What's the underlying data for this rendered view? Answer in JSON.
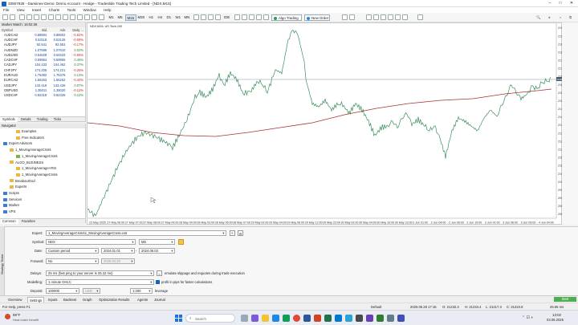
{
  "window": {
    "title": "33507928 - Darwinex-Demo: Demo Account - Hedge - Tradeslide Trading Tech Limited - [NDX,M15]"
  },
  "menu": [
    "File",
    "View",
    "Insert",
    "Charts",
    "Tools",
    "Window",
    "Help"
  ],
  "toolbar": {
    "timeframes": [
      "M1",
      "M5",
      "M15",
      "M30",
      "H1",
      "H4",
      "D1",
      "W1",
      "MN"
    ],
    "active_timeframe": "M15",
    "ide_label": "IDE",
    "algo_label": "Algo Trading",
    "new_order_label": "New Order"
  },
  "market_watch": {
    "title": "Market Watch: 16:02:36",
    "columns": [
      "Symbol",
      "Bid",
      "Ask",
      "Daily ..."
    ],
    "rows": [
      {
        "symbol": "AUDCAD",
        "bid": "0.88594",
        "ask": "0.88602",
        "change": "-0.52%"
      },
      {
        "symbol": "AUDCHF",
        "bid": "0.53118",
        "ask": "0.53126",
        "change": "-0.08%"
      },
      {
        "symbol": "AUDJPY",
        "bid": "92.541",
        "ask": "92.553",
        "change": "-0.17%"
      },
      {
        "symbol": "AUDNZD",
        "bid": "1.07599",
        "ask": "1.07610",
        "change": "0.02%"
      },
      {
        "symbol": "AUDUSD",
        "bid": "0.64528",
        "ask": "0.64533",
        "change": "-0.65%"
      },
      {
        "symbol": "CADCHF",
        "bid": "0.59954",
        "ask": "0.59965",
        "change": "0.45%"
      },
      {
        "symbol": "CADJPY",
        "bid": "104.433",
        "ask": "104.462",
        "change": "0.37%"
      },
      {
        "symbol": "CHFJPY",
        "bid": "174.205",
        "ask": "174.221",
        "change": "-0.26%"
      },
      {
        "symbol": "EURAUD",
        "bid": "1.76382",
        "ask": "1.76376",
        "change": "0.13%"
      },
      {
        "symbol": "EURCAD",
        "bid": "1.56253",
        "ask": "1.56262",
        "change": "-0.40%"
      },
      {
        "symbol": "USDJPY",
        "bid": "143.419",
        "ask": "143.426",
        "change": "0.07%"
      },
      {
        "symbol": "GBPUSD",
        "bid": "1.35011",
        "ask": "1.35020",
        "change": "-0.12%"
      },
      {
        "symbol": "USDCHF",
        "bid": "0.82318",
        "ask": "0.82325",
        "change": "0.12%"
      }
    ],
    "tabs": [
      "Symbols",
      "Details",
      "Trading",
      "Ticks"
    ]
  },
  "navigator": {
    "title": "Navigator",
    "items": [
      {
        "label": "Examples",
        "indent": 2,
        "kind": "folder"
      },
      {
        "label": "Free Indicators",
        "indent": 2,
        "kind": "folder"
      },
      {
        "label": "Expert Advisors",
        "indent": 0,
        "kind": "folder-blue"
      },
      {
        "label": "1_MovingAverageCross",
        "indent": 1,
        "kind": "folder"
      },
      {
        "label": "1_MovingAverageCross",
        "indent": 2,
        "kind": "ea"
      },
      {
        "label": "ALGO_BUSINESS",
        "indent": 1,
        "kind": "folder"
      },
      {
        "label": "1_MovingAverage+RSI",
        "indent": 2,
        "kind": "folder"
      },
      {
        "label": "1_MovingAverageCross",
        "indent": 2,
        "kind": "folder"
      },
      {
        "label": "BreakoutGod",
        "indent": 1,
        "kind": "folder"
      },
      {
        "label": "Experts",
        "indent": 1,
        "kind": "folder"
      },
      {
        "label": "Scripts",
        "indent": 0,
        "kind": "folder-blue"
      },
      {
        "label": "Services",
        "indent": 0,
        "kind": "folder-blue"
      },
      {
        "label": "Market",
        "indent": 0,
        "kind": "folder-blue"
      },
      {
        "label": "VPS",
        "indent": 0,
        "kind": "folder-blue"
      }
    ],
    "tabs": [
      "Common",
      "Favorites"
    ]
  },
  "chart": {
    "label": "NDX,M15: US Tech 100",
    "price_labels": [
      "21950.0",
      "21900.0",
      "21850.0",
      "21800.0",
      "21750.0",
      "21700.0",
      "21650.0",
      "21600.0",
      "21550.0",
      "21500.0",
      "21450.0",
      "21400.0",
      "21350.0",
      "21300.0",
      "21250.0",
      "21200.0",
      "21150.0",
      "21100.0",
      "21050.0",
      "21000.0",
      "20950.0",
      "20900.0",
      "20850.0",
      "20800.0"
    ],
    "current_price_label": "21594.6",
    "time_labels": [
      "23 May 2025",
      "27 May 06:00",
      "27 May 07:00",
      "27 May 08:00",
      "27 May 09:00",
      "28 May 00:00",
      "28 May 03:00",
      "28 May 05:00",
      "28 May 07:00",
      "29 May 02:00",
      "29 May 04:00",
      "29 May 06:00",
      "29 May 12:00",
      "29 May 23:00",
      "30 May 02:00",
      "30 May 04:00",
      "30 May 10:00",
      "30 May 23:00",
      "2 Jun 01:00",
      "2 Jun 04:00",
      "2 Jun 06:00",
      "2 Jun 15:00",
      "3 Jun 01:00",
      "3 Jun 06:00",
      "3 Jun 09:00",
      "4 Jun 04:00"
    ],
    "price_color": "#3a8f5c",
    "ma_color": "#a83232"
  },
  "tester": {
    "expert_label": "Expert:",
    "expert_value": "1_MovingAverageCross\\1_MovingAverageCross.ex5",
    "symbol_label": "Symbol:",
    "symbol_value": "NDX",
    "timeframe_value": "M5",
    "date_label": "Date:",
    "date_mode": "Custom period",
    "date_from": "2024.01.01",
    "date_to": "2024.06.02",
    "forward_label": "Forward:",
    "forward_value": "No",
    "forward_date": "2025.04.20",
    "delays_label": "Delays:",
    "delays_value": "25 ms (fast ping to your server is 25.22 ms)",
    "emulate_label": "emulate slippage and requotes during trade execution",
    "modelling_label": "Modelling:",
    "modelling_value": "1 minute OHLC",
    "profit_pips_label": "profit in pips for faster calculations",
    "deposit_label": "Deposit:",
    "deposit_value": "100000",
    "currency_value": "USD",
    "leverage_value": "1:200",
    "leverage_label": "leverage",
    "side_label": "Strategy Tester"
  },
  "bottom_tabs": [
    "Overview",
    "Settings",
    "Inputs",
    "Backtest",
    "Graph",
    "Optimization Results",
    "Agents",
    "Journal"
  ],
  "active_bottom_tab": "Settings",
  "start_label": "Start",
  "status": {
    "help": "For Help, press F1",
    "profile": "Default",
    "time": "2025.05.28 17:15",
    "open": "O: 21232.3",
    "high": "H: 21234.4",
    "low": "L: 21217.3",
    "close": "C: 21224.8",
    "network": "25.55 ms"
  },
  "taskbar": {
    "weather_temp": "98°F",
    "weather_desc": "Sunny",
    "weather_sub": "Heat index benefit",
    "search_placeholder": "Search",
    "clock_time": "13:02",
    "clock_date": "03.06.2025"
  }
}
